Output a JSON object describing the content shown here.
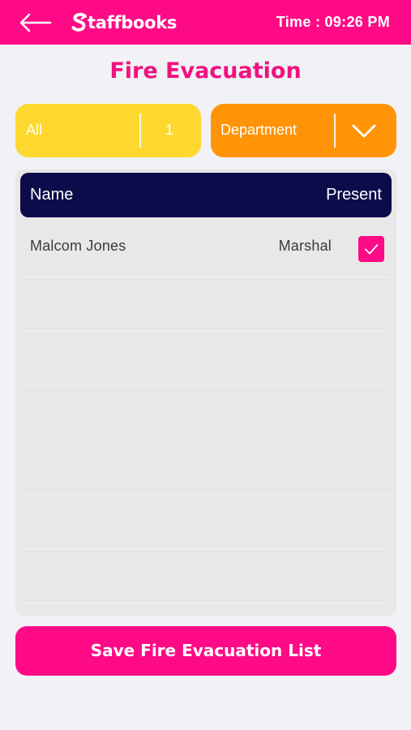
{
  "app": {
    "brand_name": "taffbooks",
    "time_display": "Time : 09:26 PM"
  },
  "colors": {
    "brand_pink": "#ff0a86",
    "title_pink": "#f0117f",
    "filter_yellow": "#fed82f",
    "filter_orange": "#ff9408",
    "table_header_navy": "#0c0c4a"
  },
  "icons": {
    "back": "back-arrow-icon",
    "logo": "staffbooks-logo",
    "dropdown": "chevron-down-icon",
    "check": "checkmark-icon"
  },
  "page": {
    "title": "Fire Evacuation"
  },
  "filters": {
    "all_label": "All",
    "all_count": "1",
    "department_label": "Department"
  },
  "table": {
    "columns": [
      "Name",
      "Present"
    ],
    "rows": [
      {
        "name": "Malcom Jones",
        "role": "Marshal",
        "present": true
      }
    ],
    "empty_rows": 6
  },
  "actions": {
    "save_label": "Save Fire Evacuation List"
  }
}
